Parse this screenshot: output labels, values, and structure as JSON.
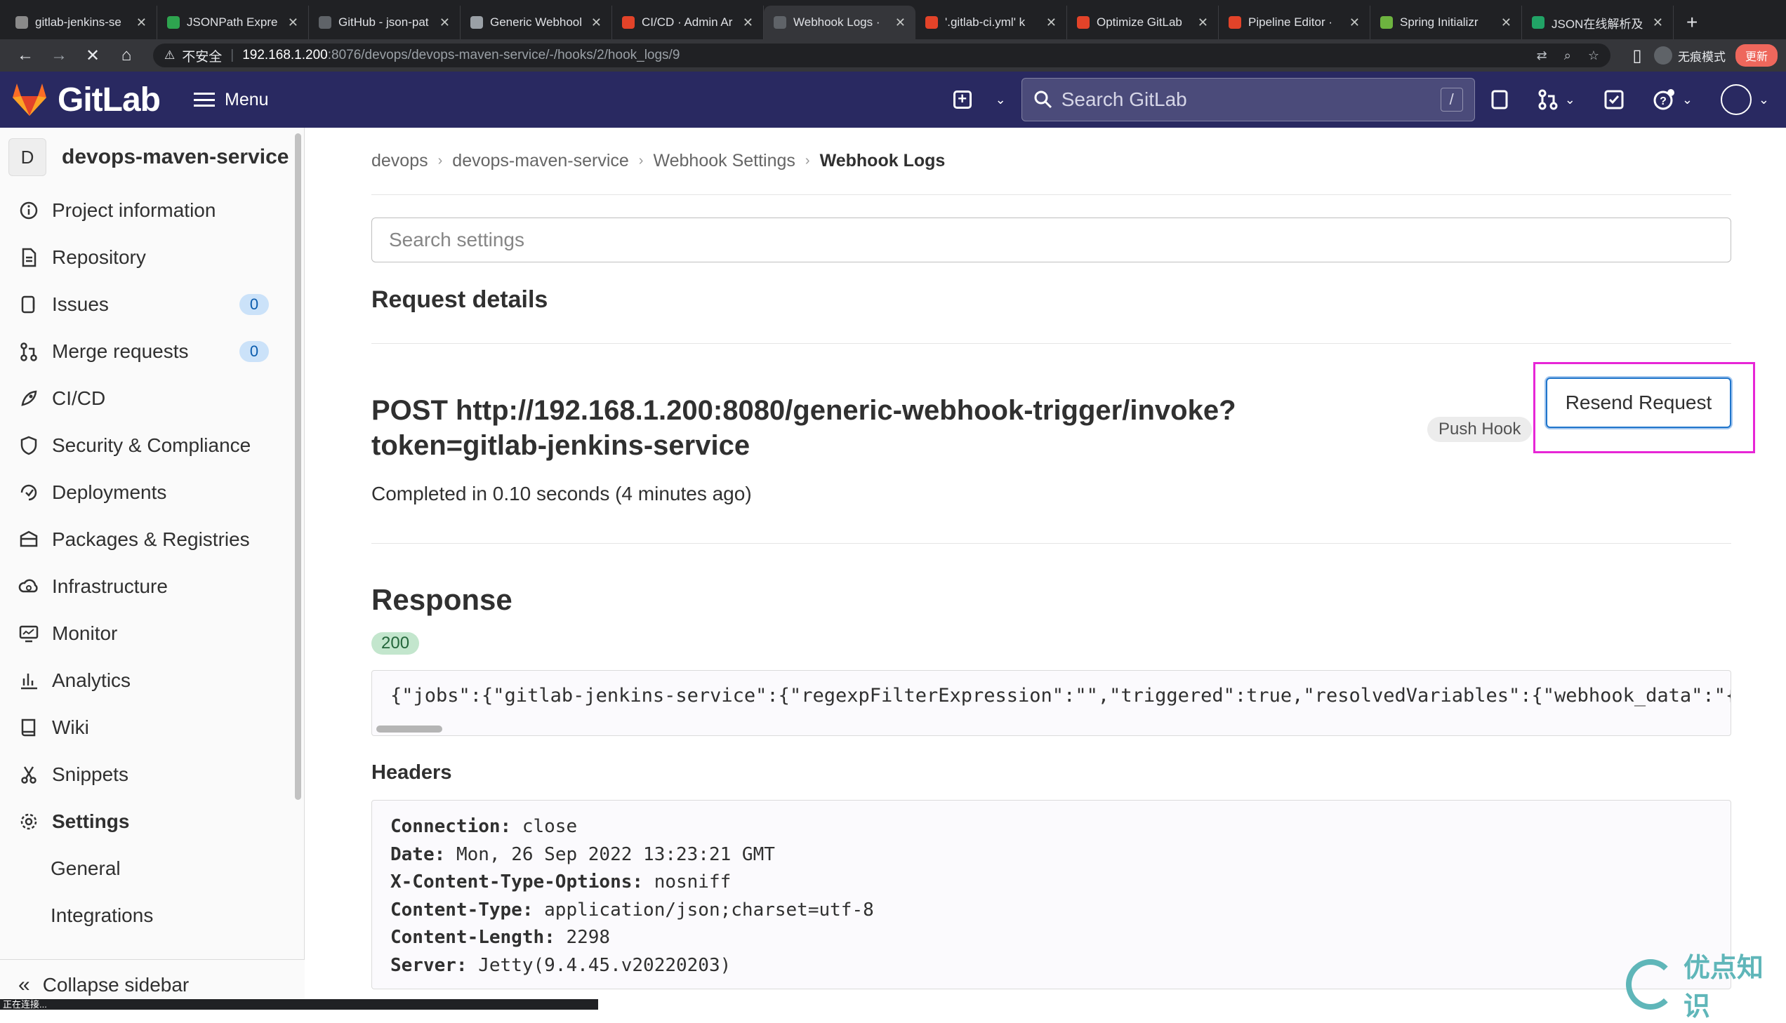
{
  "browser": {
    "tabs": [
      {
        "title": "gitlab-jenkins-se",
        "color": "#8a8a8a",
        "active": false
      },
      {
        "title": "JSONPath Expre",
        "color": "#2ea44f",
        "active": false
      },
      {
        "title": "GitHub - json-pat",
        "color": "#5f6368",
        "active": false
      },
      {
        "title": "Generic Webhool",
        "color": "#9aa0a6",
        "active": false
      },
      {
        "title": "CI/CD · Admin Ar",
        "color": "#e24329",
        "active": false
      },
      {
        "title": "Webhook Logs ·",
        "color": "#5f6368",
        "active": true
      },
      {
        "title": "'.gitlab-ci.yml' k",
        "color": "#e24329",
        "active": false
      },
      {
        "title": "Optimize GitLab",
        "color": "#e24329",
        "active": false
      },
      {
        "title": "Pipeline Editor ·",
        "color": "#e24329",
        "active": false
      },
      {
        "title": "Spring Initializr",
        "color": "#6db33f",
        "active": false
      },
      {
        "title": "JSON在线解析及",
        "color": "#21a366",
        "active": false
      }
    ],
    "insecure_label": "不安全",
    "url_host": "192.168.1.200",
    "url_path": ":8076/devops/devops-maven-service/-/hooks/2/hook_logs/9",
    "incognito_label": "无痕模式",
    "update_label": "更新",
    "status_text": "正在连接..."
  },
  "header": {
    "brand": "GitLab",
    "menu_label": "Menu",
    "search_placeholder": "Search GitLab",
    "search_shortcut": "/"
  },
  "sidebar": {
    "project_initial": "D",
    "project_name": "devops-maven-service",
    "items": [
      {
        "label": "Project information",
        "icon": "info-icon"
      },
      {
        "label": "Repository",
        "icon": "document-icon"
      },
      {
        "label": "Issues",
        "icon": "issues-icon",
        "count": "0"
      },
      {
        "label": "Merge requests",
        "icon": "merge-request-icon",
        "count": "0"
      },
      {
        "label": "CI/CD",
        "icon": "rocket-icon"
      },
      {
        "label": "Security & Compliance",
        "icon": "shield-icon"
      },
      {
        "label": "Deployments",
        "icon": "deployments-icon"
      },
      {
        "label": "Packages & Registries",
        "icon": "package-icon"
      },
      {
        "label": "Infrastructure",
        "icon": "cloud-gear-icon"
      },
      {
        "label": "Monitor",
        "icon": "monitor-icon"
      },
      {
        "label": "Analytics",
        "icon": "chart-icon"
      },
      {
        "label": "Wiki",
        "icon": "book-icon"
      },
      {
        "label": "Snippets",
        "icon": "scissors-icon"
      },
      {
        "label": "Settings",
        "icon": "gear-icon"
      }
    ],
    "sub_items": [
      "General",
      "Integrations"
    ],
    "collapse_label": "Collapse sidebar"
  },
  "main": {
    "breadcrumbs": [
      "devops",
      "devops-maven-service",
      "Webhook Settings",
      "Webhook Logs"
    ],
    "search_placeholder": "Search settings",
    "request_title": "Request details",
    "request_url_line1": "POST http://192.168.1.200:8080/generic-webhook-trigger/invoke?",
    "request_url_line2": "token=gitlab-jenkins-service",
    "completed_text": "Completed in 0.10 seconds (4 minutes ago)",
    "hook_badge": "Push Hook",
    "resend_label": "Resend Request",
    "response_title": "Response",
    "status_code": "200",
    "response_body": "{\"jobs\":{\"gitlab-jenkins-service\":{\"regexpFilterExpression\":\"\",\"triggered\":true,\"resolvedVariables\":{\"webhook_data\":\"{\\\"o",
    "headers_title": "Headers",
    "headers": [
      {
        "key": "Connection:",
        "value": "close"
      },
      {
        "key": "Date:",
        "value": "Mon, 26 Sep 2022 13:23:21 GMT"
      },
      {
        "key": "X-Content-Type-Options:",
        "value": "nosniff"
      },
      {
        "key": "Content-Type:",
        "value": "application/json;charset=utf-8"
      },
      {
        "key": "Content-Length:",
        "value": "2298"
      },
      {
        "key": "Server:",
        "value": "Jetty(9.4.45.v20220203)"
      }
    ]
  },
  "watermark": "优点知识"
}
